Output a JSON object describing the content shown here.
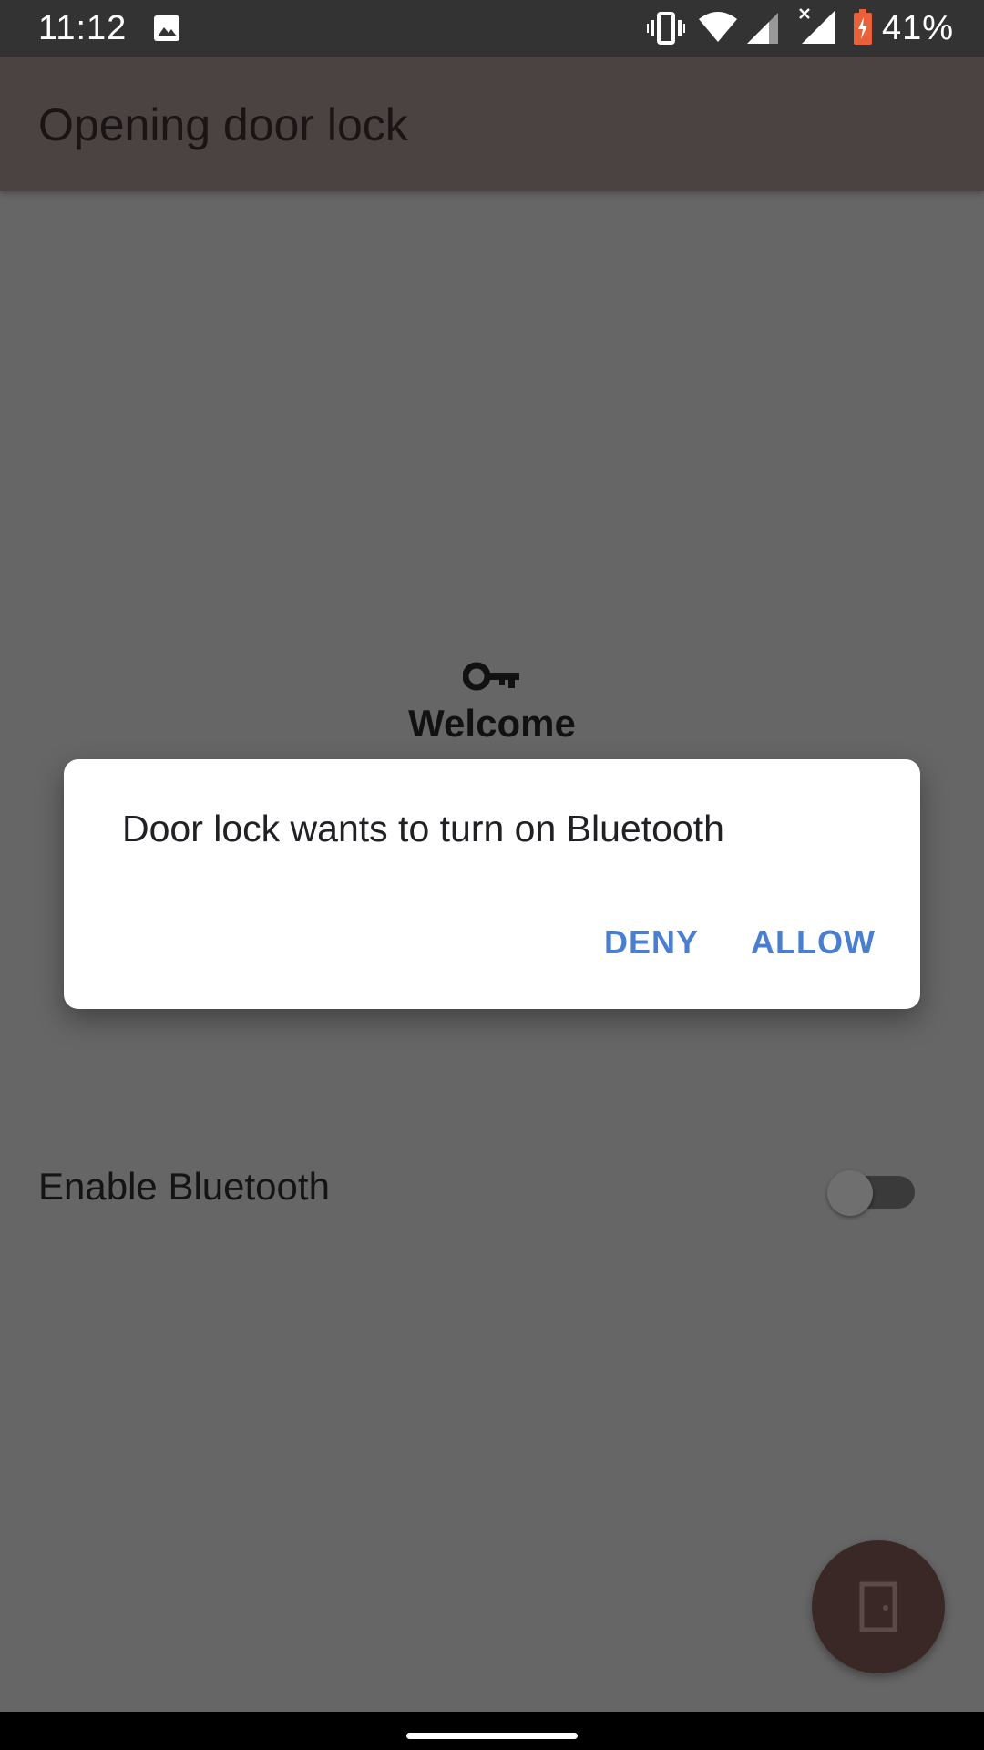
{
  "status_bar": {
    "time": "11:12",
    "battery_percent": "41%",
    "icons": [
      "image-icon",
      "vibrate-icon",
      "wifi-icon",
      "signal-icon",
      "no-signal-icon",
      "battery-charging-icon"
    ]
  },
  "app_bar": {
    "title": "Opening door lock"
  },
  "main": {
    "icon": "key-icon",
    "welcome": "Welcome",
    "bluetooth_label": "Enable Bluetooth",
    "bluetooth_enabled": false
  },
  "dialog": {
    "message": "Door lock wants to turn on Bluetooth",
    "deny_label": "DENY",
    "allow_label": "ALLOW",
    "button_color": "#4a7fd0"
  },
  "fab": {
    "icon": "door-icon",
    "color": "#3a2826"
  },
  "colors": {
    "app_bar": "#4b4242",
    "scrim_background": "#666666"
  }
}
